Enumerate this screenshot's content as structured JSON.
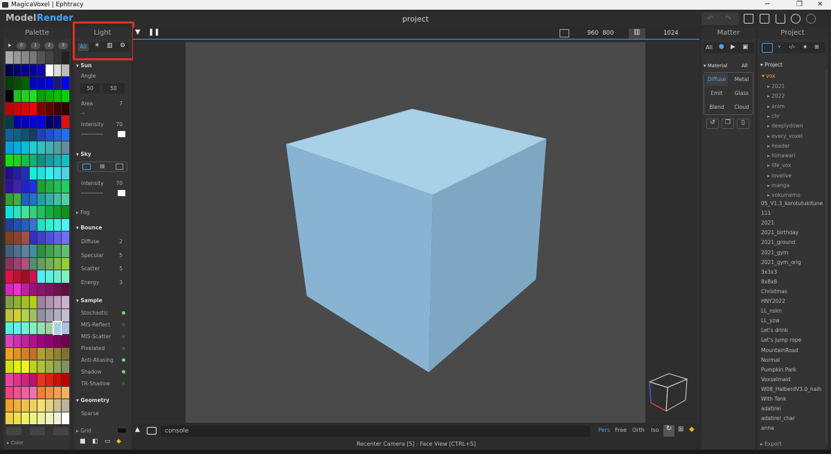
{
  "window": {
    "title": "MagicaVoxel | Ephtracy",
    "minimize": "─",
    "maximize": "❐",
    "close": "✕"
  },
  "menu": {
    "model": "Model",
    "render": "Render",
    "project_title": "project"
  },
  "palette": {
    "header": "Palette",
    "page_tabs": [
      "0",
      "1",
      "2",
      "3"
    ],
    "play": "▶",
    "footer": "Color",
    "footer_arrow": "▸"
  },
  "light": {
    "header": "Light",
    "tabs": [
      "All"
    ],
    "sun": {
      "label": "Sun",
      "angle_label": "Angle",
      "angle_values": [
        "50",
        "50"
      ],
      "area_label": "Area",
      "area_value": "7",
      "intensity_label": "Intensity",
      "intensity_value": "70"
    },
    "sky": {
      "label": "Sky",
      "intensity_label": "Intensity",
      "intensity_value": "70"
    },
    "fog": {
      "label": "Fog"
    },
    "bounce": {
      "label": "Bounce",
      "rows": [
        {
          "label": "Diffuse",
          "value": "2"
        },
        {
          "label": "Specular",
          "value": "5"
        },
        {
          "label": "Scatter",
          "value": "5"
        },
        {
          "label": "Energy",
          "value": "3"
        }
      ]
    },
    "sample": {
      "label": "Sample",
      "rows": [
        {
          "label": "Stochastic",
          "on": true
        },
        {
          "label": "MIS-Reflect",
          "on": false
        },
        {
          "label": "MIS-Scatter",
          "on": false
        },
        {
          "label": "Pixelated",
          "on": false
        },
        {
          "label": "Anti-Aliasing",
          "on": true
        },
        {
          "label": "Shadow",
          "on": true
        },
        {
          "label": "TR-Shadow",
          "on": false
        }
      ]
    },
    "geometry": {
      "label": "Geometry",
      "sparse": "Sparse",
      "grid": "Grid"
    }
  },
  "viewport": {
    "res_w": "960",
    "res_h": "800",
    "samples": "1024",
    "console": "console",
    "views": [
      "Pers",
      "Free",
      "Orth",
      "Iso"
    ],
    "status": "Recenter Camera [5] : Face View [CTRL+5]"
  },
  "matter": {
    "header": "Matter",
    "tab_all": "All",
    "material_label": "Material",
    "material_all": "All",
    "types": [
      "Diffuse",
      "Metal",
      "Emit",
      "Glass",
      "Blend",
      "Cloud"
    ]
  },
  "project": {
    "header": "Project",
    "root": "Project",
    "folder": "vox",
    "subfolders": [
      "2021",
      "2022",
      "anim",
      "chr",
      "deeplydown",
      "every_voxel",
      "header",
      "himawari",
      "life_vox",
      "lovelive",
      "manga",
      "vokumemo"
    ],
    "files": [
      "05_V1.3_korotutukitune",
      "111",
      "2021",
      "2021_birthday",
      "2021_ground",
      "2021_gym",
      "2021_gym_orig",
      "3x3x3",
      "8x8x8",
      "Christmas",
      "HNY2022",
      "LL_nskn",
      "LL_yzw",
      "Let's drink",
      "Let's jump rope",
      "MountainRoad",
      "Normal",
      "Pumpkin Park",
      "Voxselmaid",
      "W08_HalberdV3.0_haih",
      "With Tank",
      "adatirei",
      "adatirei_char",
      "anna"
    ],
    "export": "Export"
  },
  "colors": {
    "accent": "#4aa3f0",
    "highlight_box": "#e03020",
    "cube_light": "#a8d0e6",
    "cube_left": "#88b4d2",
    "cube_right": "#7ea7c4",
    "viewport_bg": "#4a4a4a"
  }
}
